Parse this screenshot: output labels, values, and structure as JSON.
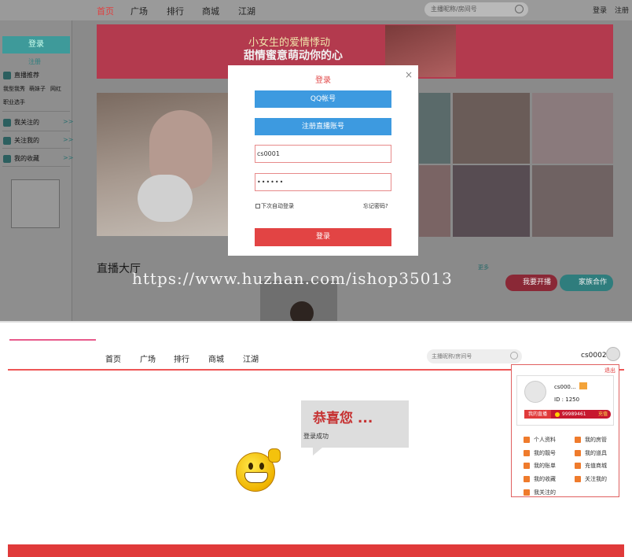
{
  "top": {
    "nav": [
      "首页",
      "广场",
      "排行",
      "商城",
      "江湖"
    ],
    "search_placeholder": "主播昵称/房间号",
    "login_link": "登录",
    "register_link": "注册",
    "sidebar": {
      "login_button": "登录",
      "register_link": "注册",
      "recommend_title": "直播推荐",
      "recommend_tags": [
        "我型我秀",
        "萌妹子",
        "网红",
        "职业选手"
      ],
      "items": [
        "我关注的",
        "关注我的",
        "我的收藏"
      ],
      "arrow": ">>"
    },
    "banner": {
      "line1": "小女生的爱情悸动",
      "line2": "甜情蜜意萌动你的心"
    },
    "hall_title": "直播大厅",
    "more": "更多",
    "btn_live": "我要开播",
    "btn_family": "家族合作",
    "modal": {
      "title": "登录",
      "close": "×",
      "qq_button": "QQ帐号",
      "register_button": "注册直播账号",
      "username_value": "cs0001",
      "password_value": "••••••",
      "auto_login": "下次自动登录",
      "forgot": "忘记密码?",
      "login_button": "登录"
    },
    "watermark": "https://www.huzhan.com/ishop35013"
  },
  "bottom": {
    "nav": [
      "首页",
      "广场",
      "排行",
      "商城",
      "江湖"
    ],
    "search_placeholder": "主播昵称/房间号",
    "username": "cs0002",
    "congrats": "恭喜您 ...",
    "success": "登录成功",
    "dropdown": {
      "logout": "退出",
      "name": "cs000...",
      "id": "ID : 1250",
      "live_button": "我的直播",
      "coins": "99989461",
      "recharge": "充值",
      "items": [
        "个人资料",
        "我的房管",
        "我的靓号",
        "我的道具",
        "我的账单",
        "充值商城",
        "我的收藏",
        "关注我的",
        "我关注的"
      ]
    }
  }
}
